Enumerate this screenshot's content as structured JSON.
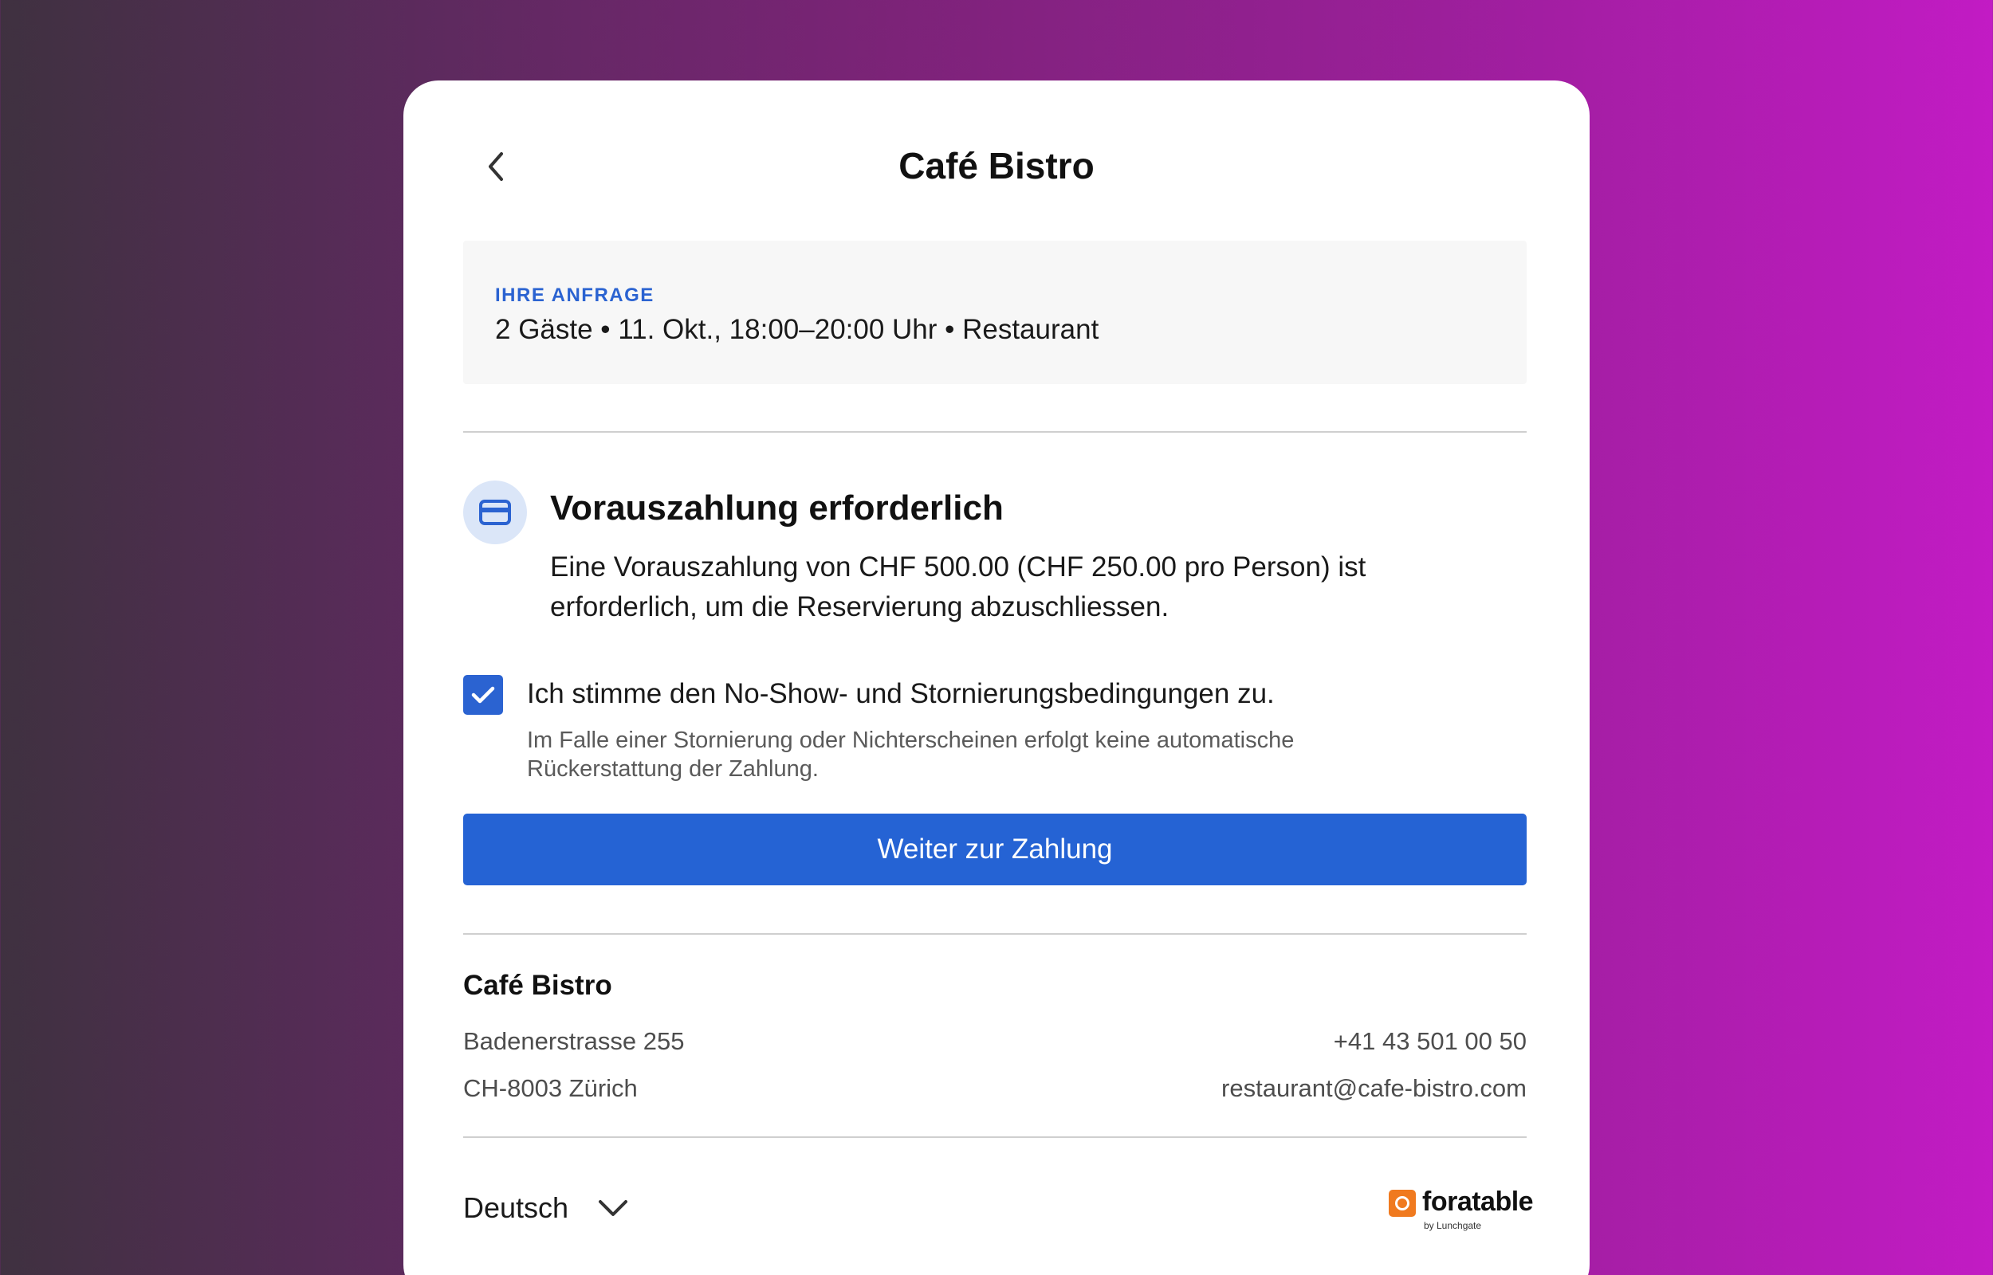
{
  "header": {
    "title": "Café Bistro",
    "back_icon": "chevron-left-icon"
  },
  "request": {
    "label": "IHRE ANFRAGE",
    "summary": "2 Gäste • 11. Okt., 18:00–20:00 Uhr • Restaurant"
  },
  "payment": {
    "icon": "credit-card-icon",
    "title": "Vorauszahlung erforderlich",
    "description": "Eine Vorauszahlung von CHF 500.00 (CHF 250.00 pro Person) ist erforderlich, um die Reservierung abzuschliessen."
  },
  "consent": {
    "checked": true,
    "label": "Ich stimme den No-Show- und Stornierungsbedingungen zu.",
    "note": "Im Falle einer Stornierung oder Nichterscheinen erfolgt keine automatische Rückerstattung der Zahlung."
  },
  "cta": {
    "label": "Weiter zur Zahlung"
  },
  "restaurant": {
    "name": "Café Bistro",
    "street": "Badenerstrasse 255",
    "city": "CH-8003 Zürich",
    "phone": "+41 43 501 00 50",
    "email": "restaurant@cafe-bistro.com"
  },
  "footer": {
    "language": "Deutsch",
    "brand_name": "foratable",
    "brand_sub": "by Lunchgate"
  },
  "colors": {
    "accent": "#2563d4",
    "label_blue": "#2b63d1",
    "brand_orange": "#f07a1f"
  }
}
